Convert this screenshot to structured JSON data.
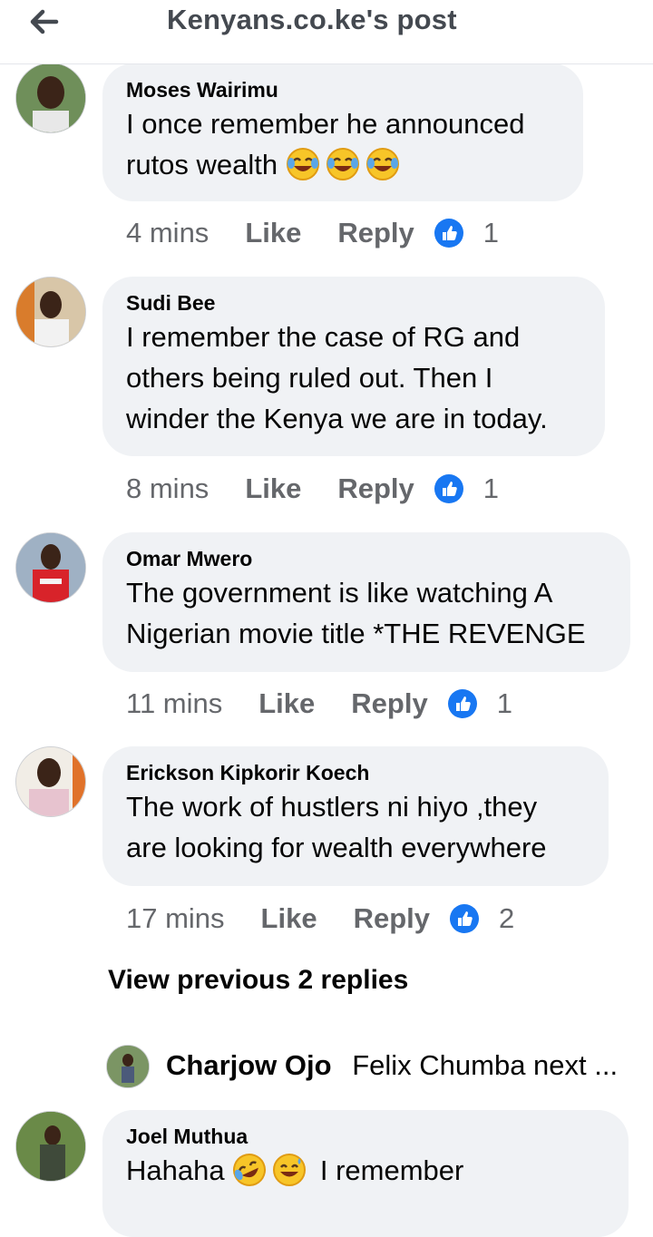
{
  "header": {
    "title": "Kenyans.co.ke's post",
    "back_icon": "arrow-left-icon"
  },
  "comments": [
    {
      "name": "Moses Wairimu",
      "text_lines": [
        "I once remember he announced",
        "rutos wealth"
      ],
      "emoji": [
        "😂",
        "😂",
        "😂"
      ],
      "time": "4 mins",
      "like": "Like",
      "reply": "Reply",
      "reactions": "1"
    },
    {
      "name": "Sudi Bee",
      "text_lines": [
        "I remember the case of RG and",
        "others being ruled out. Then I",
        "winder the Kenya we are in today."
      ],
      "time": "8 mins",
      "like": "Like",
      "reply": "Reply",
      "reactions": "1"
    },
    {
      "name": "Omar Mwero",
      "text_lines": [
        "The government is like watching A",
        "Nigerian movie title *THE REVENGE"
      ],
      "time": "11 mins",
      "like": "Like",
      "reply": "Reply",
      "reactions": "1"
    },
    {
      "name": "Erickson Kipkorir Koech",
      "text_lines": [
        "The work of hustlers ni hiyo ,they",
        "are looking for wealth everywhere"
      ],
      "time": "17 mins",
      "like": "Like",
      "reply": "Reply",
      "reactions": "2"
    }
  ],
  "view_previous": "View previous 2 replies",
  "nested_reply": {
    "name": "Charjow Ojo",
    "text": "Felix Chumba next ..."
  },
  "last_comment": {
    "name": "Joel Muthua",
    "text": "I remember",
    "prefix": "Hahaha",
    "emoji": [
      "🤣",
      "😅"
    ]
  },
  "colors": {
    "like_blue": "#1877f2",
    "bubble": "#f0f2f5",
    "meta": "#65676b"
  }
}
